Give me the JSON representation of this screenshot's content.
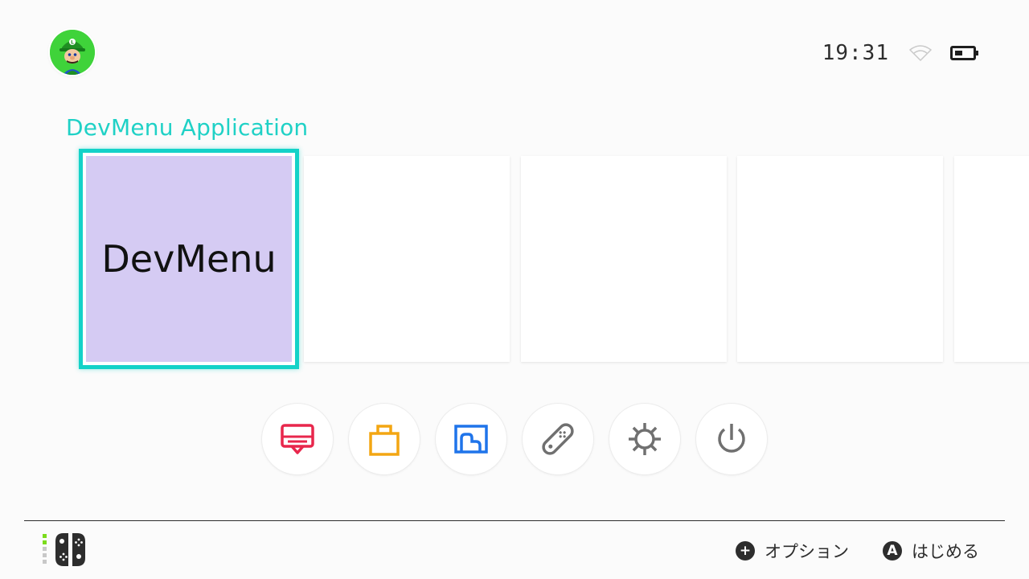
{
  "status": {
    "time": "19:31",
    "wifi_icon": "wifi-icon",
    "battery_icon": "battery-icon"
  },
  "user": {
    "avatar_icon": "avatar-luigi-icon"
  },
  "section": {
    "title": "DevMenu Application"
  },
  "tiles": [
    {
      "label": "DevMenu",
      "selected": true,
      "color": "#d5cbf3"
    }
  ],
  "quick_menu": [
    {
      "name": "news",
      "icon": "news-icon",
      "color": "#e8274c"
    },
    {
      "name": "eshop",
      "icon": "shopping-bag-icon",
      "color": "#f3a612"
    },
    {
      "name": "album",
      "icon": "album-icon",
      "color": "#1f74ea"
    },
    {
      "name": "controllers",
      "icon": "controller-icon",
      "color": "#707070"
    },
    {
      "name": "system-settings",
      "icon": "gear-icon",
      "color": "#707070"
    },
    {
      "name": "sleep-mode",
      "icon": "power-icon",
      "color": "#707070"
    }
  ],
  "footer": {
    "options_button": "+",
    "options_label": "オプション",
    "start_button": "A",
    "start_label": "はじめる"
  },
  "colors": {
    "accent": "#1fd1c6",
    "background": "#fbfbfb"
  }
}
